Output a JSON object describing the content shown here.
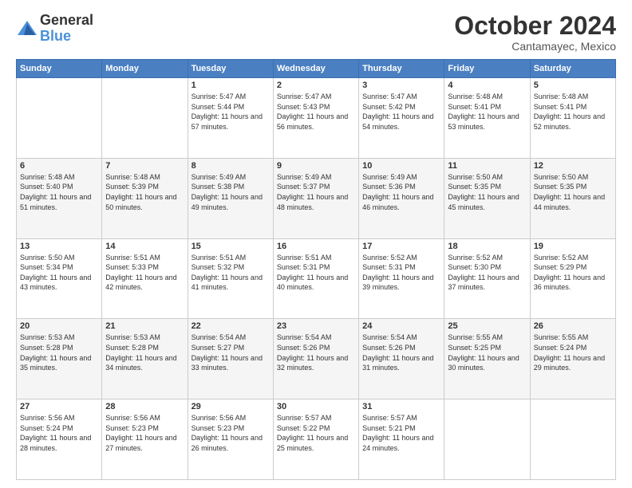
{
  "logo": {
    "general": "General",
    "blue": "Blue"
  },
  "title": "October 2024",
  "location": "Cantamayec, Mexico",
  "weekdays": [
    "Sunday",
    "Monday",
    "Tuesday",
    "Wednesday",
    "Thursday",
    "Friday",
    "Saturday"
  ],
  "weeks": [
    [
      {
        "day": "",
        "info": ""
      },
      {
        "day": "",
        "info": ""
      },
      {
        "day": "1",
        "info": "Sunrise: 5:47 AM\nSunset: 5:44 PM\nDaylight: 11 hours and 57 minutes."
      },
      {
        "day": "2",
        "info": "Sunrise: 5:47 AM\nSunset: 5:43 PM\nDaylight: 11 hours and 56 minutes."
      },
      {
        "day": "3",
        "info": "Sunrise: 5:47 AM\nSunset: 5:42 PM\nDaylight: 11 hours and 54 minutes."
      },
      {
        "day": "4",
        "info": "Sunrise: 5:48 AM\nSunset: 5:41 PM\nDaylight: 11 hours and 53 minutes."
      },
      {
        "day": "5",
        "info": "Sunrise: 5:48 AM\nSunset: 5:41 PM\nDaylight: 11 hours and 52 minutes."
      }
    ],
    [
      {
        "day": "6",
        "info": "Sunrise: 5:48 AM\nSunset: 5:40 PM\nDaylight: 11 hours and 51 minutes."
      },
      {
        "day": "7",
        "info": "Sunrise: 5:48 AM\nSunset: 5:39 PM\nDaylight: 11 hours and 50 minutes."
      },
      {
        "day": "8",
        "info": "Sunrise: 5:49 AM\nSunset: 5:38 PM\nDaylight: 11 hours and 49 minutes."
      },
      {
        "day": "9",
        "info": "Sunrise: 5:49 AM\nSunset: 5:37 PM\nDaylight: 11 hours and 48 minutes."
      },
      {
        "day": "10",
        "info": "Sunrise: 5:49 AM\nSunset: 5:36 PM\nDaylight: 11 hours and 46 minutes."
      },
      {
        "day": "11",
        "info": "Sunrise: 5:50 AM\nSunset: 5:35 PM\nDaylight: 11 hours and 45 minutes."
      },
      {
        "day": "12",
        "info": "Sunrise: 5:50 AM\nSunset: 5:35 PM\nDaylight: 11 hours and 44 minutes."
      }
    ],
    [
      {
        "day": "13",
        "info": "Sunrise: 5:50 AM\nSunset: 5:34 PM\nDaylight: 11 hours and 43 minutes."
      },
      {
        "day": "14",
        "info": "Sunrise: 5:51 AM\nSunset: 5:33 PM\nDaylight: 11 hours and 42 minutes."
      },
      {
        "day": "15",
        "info": "Sunrise: 5:51 AM\nSunset: 5:32 PM\nDaylight: 11 hours and 41 minutes."
      },
      {
        "day": "16",
        "info": "Sunrise: 5:51 AM\nSunset: 5:31 PM\nDaylight: 11 hours and 40 minutes."
      },
      {
        "day": "17",
        "info": "Sunrise: 5:52 AM\nSunset: 5:31 PM\nDaylight: 11 hours and 39 minutes."
      },
      {
        "day": "18",
        "info": "Sunrise: 5:52 AM\nSunset: 5:30 PM\nDaylight: 11 hours and 37 minutes."
      },
      {
        "day": "19",
        "info": "Sunrise: 5:52 AM\nSunset: 5:29 PM\nDaylight: 11 hours and 36 minutes."
      }
    ],
    [
      {
        "day": "20",
        "info": "Sunrise: 5:53 AM\nSunset: 5:28 PM\nDaylight: 11 hours and 35 minutes."
      },
      {
        "day": "21",
        "info": "Sunrise: 5:53 AM\nSunset: 5:28 PM\nDaylight: 11 hours and 34 minutes."
      },
      {
        "day": "22",
        "info": "Sunrise: 5:54 AM\nSunset: 5:27 PM\nDaylight: 11 hours and 33 minutes."
      },
      {
        "day": "23",
        "info": "Sunrise: 5:54 AM\nSunset: 5:26 PM\nDaylight: 11 hours and 32 minutes."
      },
      {
        "day": "24",
        "info": "Sunrise: 5:54 AM\nSunset: 5:26 PM\nDaylight: 11 hours and 31 minutes."
      },
      {
        "day": "25",
        "info": "Sunrise: 5:55 AM\nSunset: 5:25 PM\nDaylight: 11 hours and 30 minutes."
      },
      {
        "day": "26",
        "info": "Sunrise: 5:55 AM\nSunset: 5:24 PM\nDaylight: 11 hours and 29 minutes."
      }
    ],
    [
      {
        "day": "27",
        "info": "Sunrise: 5:56 AM\nSunset: 5:24 PM\nDaylight: 11 hours and 28 minutes."
      },
      {
        "day": "28",
        "info": "Sunrise: 5:56 AM\nSunset: 5:23 PM\nDaylight: 11 hours and 27 minutes."
      },
      {
        "day": "29",
        "info": "Sunrise: 5:56 AM\nSunset: 5:23 PM\nDaylight: 11 hours and 26 minutes."
      },
      {
        "day": "30",
        "info": "Sunrise: 5:57 AM\nSunset: 5:22 PM\nDaylight: 11 hours and 25 minutes."
      },
      {
        "day": "31",
        "info": "Sunrise: 5:57 AM\nSunset: 5:21 PM\nDaylight: 11 hours and 24 minutes."
      },
      {
        "day": "",
        "info": ""
      },
      {
        "day": "",
        "info": ""
      }
    ]
  ]
}
